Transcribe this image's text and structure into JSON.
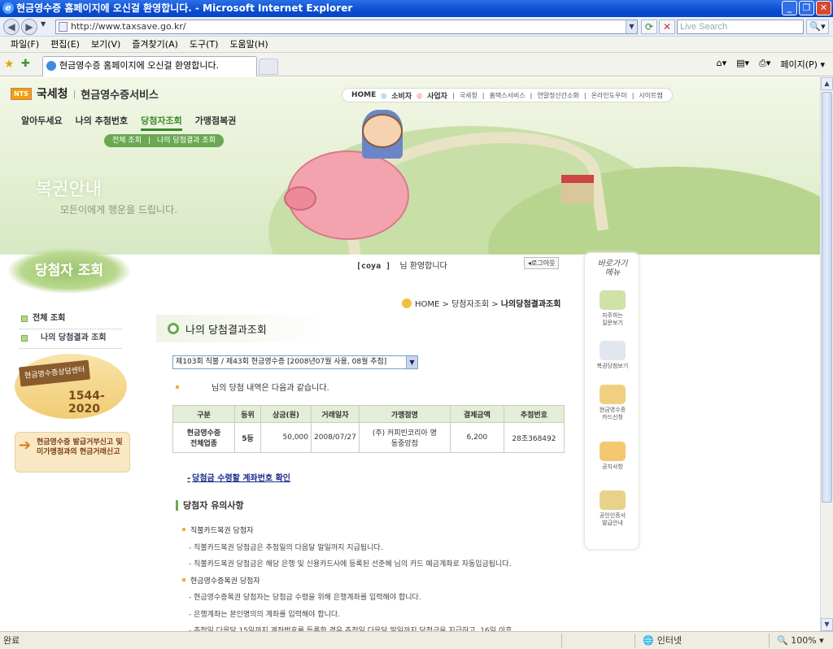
{
  "window": {
    "title": "현금영수증 홈페이지에 오신걸 환영합니다. - Microsoft Internet Explorer"
  },
  "address": {
    "url": "http://www.taxsave.go.kr/",
    "search_placeholder": "Live Search"
  },
  "menubar": [
    "파일(F)",
    "편집(E)",
    "보기(V)",
    "즐겨찾기(A)",
    "도구(T)",
    "도움말(H)"
  ],
  "tab": {
    "title": "현금영수증 홈페이지에 오신걸 환영합니다."
  },
  "toolbar": {
    "page_menu": "페이지(P) ▾"
  },
  "site": {
    "logo_nts": "NTS",
    "org": "국세청",
    "service": "현금영수증서비스",
    "topnav": [
      "HOME",
      "소비자",
      "사업자",
      "국세청",
      "홈택스서비스",
      "연말정산간소화",
      "온라인도우미",
      "사이트맵"
    ],
    "gnb": [
      "알아두세요",
      "나의 추첨번호",
      "당첨자조회",
      "가맹점복권"
    ],
    "subgnb": [
      "전체 조회",
      "나의 당첨결과 조회"
    ],
    "hero_title": "복권안내",
    "hero_sub": "모든이에게 행운을 드립니다."
  },
  "sidebar": {
    "title": "당첨자 조회",
    "items": [
      "전체 조회",
      "나의 당첨결과 조회"
    ],
    "sign_text": "현금영수증상담센터",
    "sign_number": "1544-2020",
    "banner_line1": "현금영수증 발급거부신고 및",
    "banner_line2": "미가맹점과의 현금거래신고"
  },
  "main": {
    "user": "[coya  ]",
    "welcome_suffix": "님 환영합니다",
    "logout": "◂로그아웃",
    "breadcrumb": {
      "home": "HOME",
      "sep1": " > ",
      "mid": "당첨자조회",
      "sep2": " > ",
      "current": "나의당첨결과조회"
    },
    "title": "나의 당첨결과조회",
    "round_select": "제103회 직불 / 제43회 현금영수증 [2008년07월 사용, 08월 추첨]",
    "notice": "님의 당첨 내역은 다음과 같습니다.",
    "table": {
      "headers": [
        "구분",
        "등위",
        "상금(원)",
        "거래일자",
        "가맹점명",
        "결제금액",
        "추첨번호"
      ],
      "row": {
        "type_line1": "현금영수증",
        "type_line2": "전체업종",
        "rank": "5등",
        "prize": "50,000",
        "date": "2008/07/27",
        "store_line1": "(주) 커피빈코리아 명",
        "store_line2": "동중앙점",
        "amount": "6,200",
        "ticket": "28조368492"
      }
    },
    "account_link": "당첨금 수령할 계좌번호 확인",
    "notes_title": "당첨자 유의사항",
    "notes": {
      "h1": "직불카드복권 당첨자",
      "l1": "- 직불카드복권 당첨금은 추첨일의 다음달 말일까지 지급됩니다.",
      "l2": "- 직불카드복권 당첨금은 해당 은행 및 신용카드사에 등록된 선준혜 님의 카드 예금계좌로 자동입금됩니다.",
      "h2": "현금영수증복권 당첨자",
      "l3": "- 현금영수증복권 당첨자는 당첨금 수령을 위해 은행계좌를 입력해야 합니다.",
      "l4": "- 은행계좌는 본인명의의 계좌를 입력해야 합니다.",
      "l5": "- 추첨일 다음달 15일까지 계좌번호를 등록한 경우 추첨일 다음달 말일까지 당첨금을 지급하고, 16일 이후"
    }
  },
  "quickmenu": {
    "title_line1": "바로가기",
    "title_line2": "메뉴",
    "items": [
      {
        "l1": "자주하는",
        "l2": "질문보기"
      },
      {
        "l1": "복권당첨보기",
        "l2": ""
      },
      {
        "l1": "현금영수증",
        "l2": "카드신청"
      },
      {
        "l1": "공지사항",
        "l2": ""
      },
      {
        "l1": "공인인증서",
        "l2": "발급안내"
      }
    ]
  },
  "status": {
    "left": "완료",
    "zone": "인터넷",
    "zoom": "100%"
  }
}
